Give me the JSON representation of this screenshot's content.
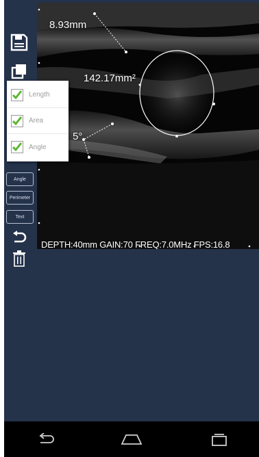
{
  "measurements": {
    "length": "8.93mm",
    "area": "142.17mm²",
    "angle_partial": "5°"
  },
  "status": "DEPTH:40mm GAIN:70 FREQ:7.0MHz FPS:16.8",
  "toolbar": {
    "buttons": [
      "Angle",
      "Perimeter",
      "Text"
    ]
  },
  "popup": {
    "items": [
      {
        "label": "Length",
        "checked": true
      },
      {
        "label": "Area",
        "checked": true
      },
      {
        "label": "Angle",
        "checked": true
      }
    ]
  },
  "colors": {
    "app_background": "#24324a",
    "viewport": "#050505",
    "checkmark": "#5cb531",
    "navbar": "#000000"
  }
}
